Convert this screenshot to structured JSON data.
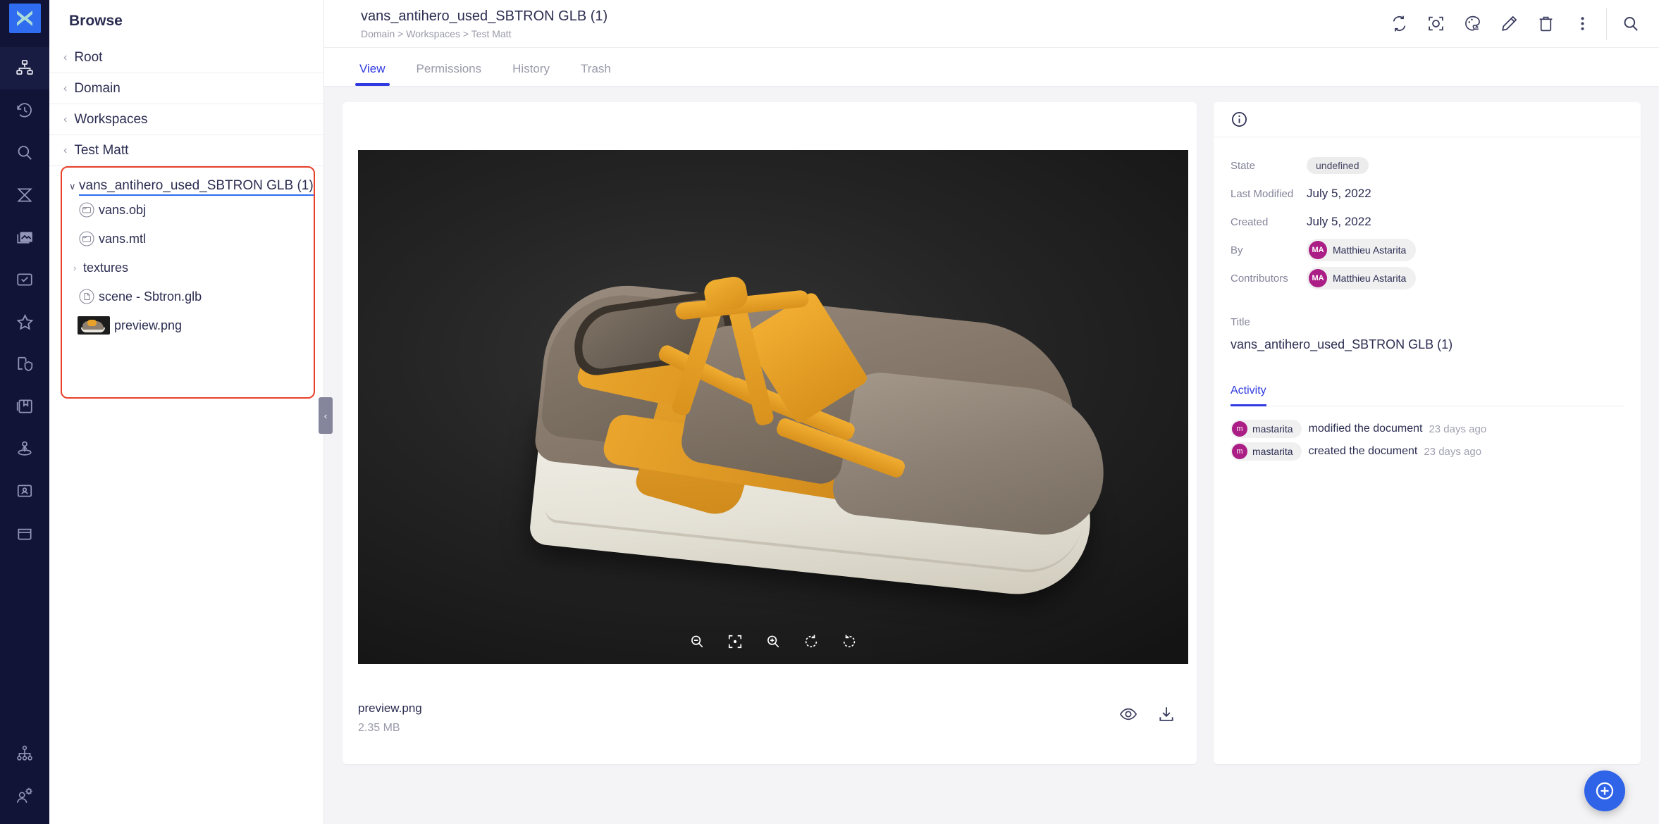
{
  "app": {
    "logo_icon": "x-logo-icon",
    "accent_blue": "#2f3ae0",
    "logo_blue": "#2f6cf0",
    "highlight_red": "#e8402a",
    "avatar_magenta": "#ab1e85"
  },
  "rail": {
    "items": [
      {
        "icon": "hierarchy-icon",
        "active": true
      },
      {
        "icon": "history-icon",
        "active": false
      },
      {
        "icon": "search-icon",
        "active": false
      },
      {
        "icon": "hourglass-icon",
        "active": false
      },
      {
        "icon": "gallery-icon",
        "active": false
      },
      {
        "icon": "tasks-icon",
        "active": false
      },
      {
        "icon": "star-icon",
        "active": false
      },
      {
        "icon": "document-shield-icon",
        "active": false
      },
      {
        "icon": "book-icon",
        "active": false
      },
      {
        "icon": "user-upload-icon",
        "active": false
      },
      {
        "icon": "id-card-icon",
        "active": false
      },
      {
        "icon": "trash-icon",
        "active": false
      }
    ],
    "bottom_items": [
      {
        "icon": "org-chart-icon"
      },
      {
        "icon": "user-settings-icon"
      }
    ]
  },
  "sidebar": {
    "title": "Browse",
    "breadcrumbs": [
      {
        "label": "Root",
        "chevron": "‹"
      },
      {
        "label": "Domain",
        "chevron": "‹"
      },
      {
        "label": "Workspaces",
        "chevron": "‹"
      },
      {
        "label": "Test Matt",
        "chevron": "‹"
      }
    ],
    "tree": {
      "root_label": "vans_antihero_used_SBTRON GLB (1)",
      "root_caret": "∨",
      "items": [
        {
          "label": "vans.obj",
          "icon": "file-obj-icon",
          "type": "file"
        },
        {
          "label": "vans.mtl",
          "icon": "file-mtl-icon",
          "type": "file"
        },
        {
          "label": "textures",
          "icon": "folder-collapsed-icon",
          "type": "folder",
          "caret": "›"
        },
        {
          "label": "scene - Sbtron.glb",
          "icon": "file-glb-icon",
          "type": "file"
        },
        {
          "label": "preview.png",
          "icon": "image-thumbnail-icon",
          "type": "image"
        }
      ]
    },
    "collapse_chevron": "‹"
  },
  "topbar": {
    "doc_title": "vans_antihero_used_SBTRON GLB (1)",
    "breadcrumb": "Domain > Workspaces > Test Matt",
    "actions": [
      {
        "icon": "sync-icon"
      },
      {
        "icon": "focus-frame-icon"
      },
      {
        "icon": "palette-icon"
      },
      {
        "icon": "pencil-edit-icon"
      },
      {
        "icon": "trash-delete-icon"
      },
      {
        "icon": "more-vertical-icon"
      }
    ],
    "search_icon": "search-icon"
  },
  "tabs": [
    {
      "label": "View",
      "active": true
    },
    {
      "label": "Permissions",
      "active": false
    },
    {
      "label": "History",
      "active": false
    },
    {
      "label": "Trash",
      "active": false
    }
  ],
  "viewer": {
    "image_alt": "preview.png",
    "toolbar": [
      {
        "icon": "zoom-out-icon"
      },
      {
        "icon": "fit-to-screen-icon"
      },
      {
        "icon": "zoom-in-icon"
      },
      {
        "icon": "rotate-left-icon"
      },
      {
        "icon": "rotate-right-icon"
      }
    ],
    "file_name": "preview.png",
    "file_size": "2.35 MB",
    "actions": [
      {
        "icon": "eye-preview-icon"
      },
      {
        "icon": "download-icon"
      }
    ]
  },
  "info": {
    "header_icon": "info-circle-icon",
    "rows": [
      {
        "key": "State",
        "value": "undefined",
        "kind": "pill"
      },
      {
        "key": "Last Modified",
        "value": "July 5, 2022",
        "kind": "text"
      },
      {
        "key": "Created",
        "value": "July 5, 2022",
        "kind": "text"
      },
      {
        "key": "By",
        "value": "Matthieu Astarita",
        "initials": "MA",
        "kind": "chip"
      },
      {
        "key": "Contributors",
        "value": "Matthieu Astarita",
        "initials": "MA",
        "kind": "chip"
      }
    ],
    "title_label": "Title",
    "title_value": "vans_antihero_used_SBTRON GLB (1)",
    "activity_tab": "Activity",
    "activity": [
      {
        "initial": "m",
        "user": "mastarita",
        "action": "modified the document",
        "time": "23 days ago"
      },
      {
        "initial": "m",
        "user": "mastarita",
        "action": "created the document",
        "time": "23 days ago"
      }
    ]
  },
  "fab": {
    "icon": "add-circle-icon"
  }
}
